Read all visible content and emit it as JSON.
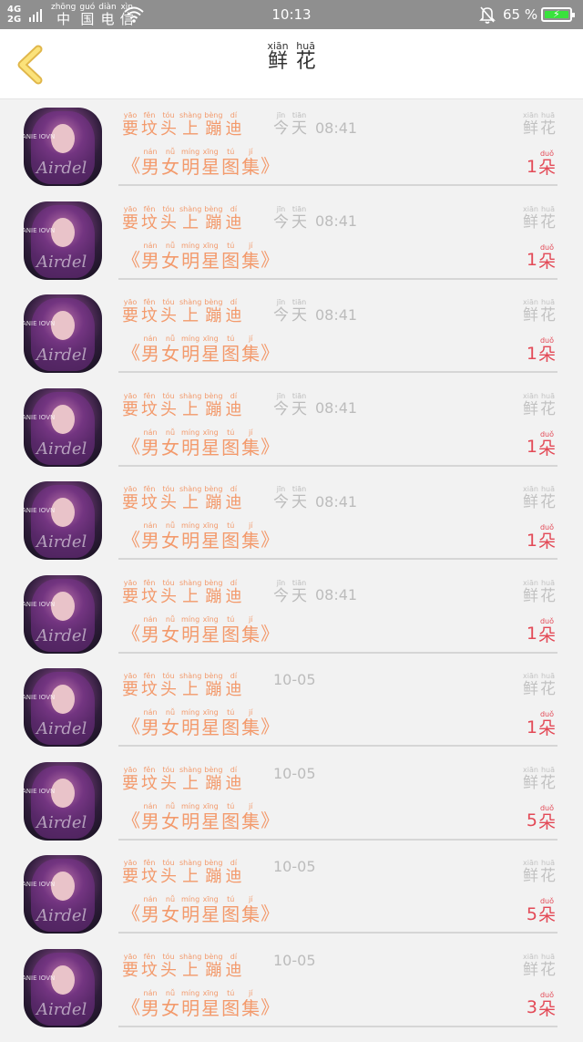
{
  "status_bar": {
    "network": [
      "4G",
      "2G"
    ],
    "carrier": [
      {
        "py": "zhōng",
        "hz": "中"
      },
      {
        "py": "guó",
        "hz": "国"
      },
      {
        "py": "diàn",
        "hz": "电"
      },
      {
        "py": "xìn",
        "hz": "信"
      }
    ],
    "time": "10:13",
    "battery": "65 %"
  },
  "header": {
    "title": [
      {
        "py": "xiān",
        "hz": "鲜"
      },
      {
        "py": "huā",
        "hz": "花"
      }
    ]
  },
  "labels": {
    "user": [
      {
        "py": "yāo",
        "hz": "要"
      },
      {
        "py": "fěn",
        "hz": "坟"
      },
      {
        "py": "tóu",
        "hz": "头"
      },
      {
        "py": "shàng",
        "hz": "上"
      },
      {
        "py": "bèng",
        "hz": "蹦"
      },
      {
        "py": "dí",
        "hz": "迪"
      }
    ],
    "today": [
      {
        "py": "jīn",
        "hz": "今"
      },
      {
        "py": "tiān",
        "hz": "天"
      }
    ],
    "gift": [
      {
        "py": "xiān",
        "hz": "鲜"
      },
      {
        "py": "huā",
        "hz": "花"
      }
    ],
    "album_open": "《",
    "album_close": "》",
    "album": [
      {
        "py": "nán",
        "hz": "男"
      },
      {
        "py": "nǚ",
        "hz": "女"
      },
      {
        "py": "míng",
        "hz": "明"
      },
      {
        "py": "xīng",
        "hz": "星"
      },
      {
        "py": "tú",
        "hz": "图"
      },
      {
        "py": "jí",
        "hz": "集"
      }
    ],
    "unit": {
      "py": "duǒ",
      "hz": "朵"
    }
  },
  "avatar_text": "Airdel",
  "avatar_text2": "ANIE IOVN",
  "rows": [
    {
      "today": true,
      "time": "08:41",
      "count": "1"
    },
    {
      "today": true,
      "time": "08:41",
      "count": "1"
    },
    {
      "today": true,
      "time": "08:41",
      "count": "1"
    },
    {
      "today": true,
      "time": "08:41",
      "count": "1"
    },
    {
      "today": true,
      "time": "08:41",
      "count": "1"
    },
    {
      "today": true,
      "time": "08:41",
      "count": "1"
    },
    {
      "today": false,
      "time": "10-05",
      "count": "1"
    },
    {
      "today": false,
      "time": "10-05",
      "count": "5"
    },
    {
      "today": false,
      "time": "10-05",
      "count": "5"
    },
    {
      "today": false,
      "time": "10-05",
      "count": "3"
    }
  ],
  "colors": {
    "accent_orange": "#f39a6c",
    "count_red": "#e34a57",
    "back_arrow_yellow": "#f2c94c",
    "status_bar": "#8f8f8f"
  }
}
